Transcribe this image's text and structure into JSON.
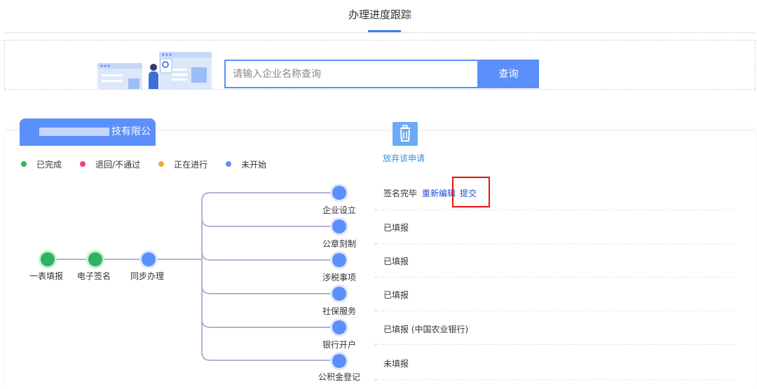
{
  "header": {
    "title": "办理进度跟踪"
  },
  "search": {
    "placeholder": "请输入企业名称查询",
    "button_label": "查询"
  },
  "company": {
    "name_visible": "技有限公司"
  },
  "actions": {
    "discard_label": "放弃该申请"
  },
  "legend": [
    {
      "label": "已完成",
      "color": "#2bb55f"
    },
    {
      "label": "退回/不通过",
      "color": "#f2436b"
    },
    {
      "label": "正在进行",
      "color": "#f6a43b"
    },
    {
      "label": "未开始",
      "color": "#5b8ff9"
    }
  ],
  "main_steps": [
    {
      "label": "一表填报",
      "state": "已完成"
    },
    {
      "label": "电子签名",
      "state": "已完成"
    },
    {
      "label": "同步办理",
      "state": "未开始"
    }
  ],
  "branches": [
    {
      "label": "企业设立",
      "status": "签名完毕",
      "links": [
        "重新编辑",
        "提交"
      ]
    },
    {
      "label": "公章刻制",
      "status": "已填报"
    },
    {
      "label": "涉税事项",
      "status": "已填报"
    },
    {
      "label": "社保服务",
      "status": "已填报"
    },
    {
      "label": "银行开户",
      "status": "已填报 (中国农业银行)"
    },
    {
      "label": "公积金登记",
      "status": "未填报"
    }
  ]
}
